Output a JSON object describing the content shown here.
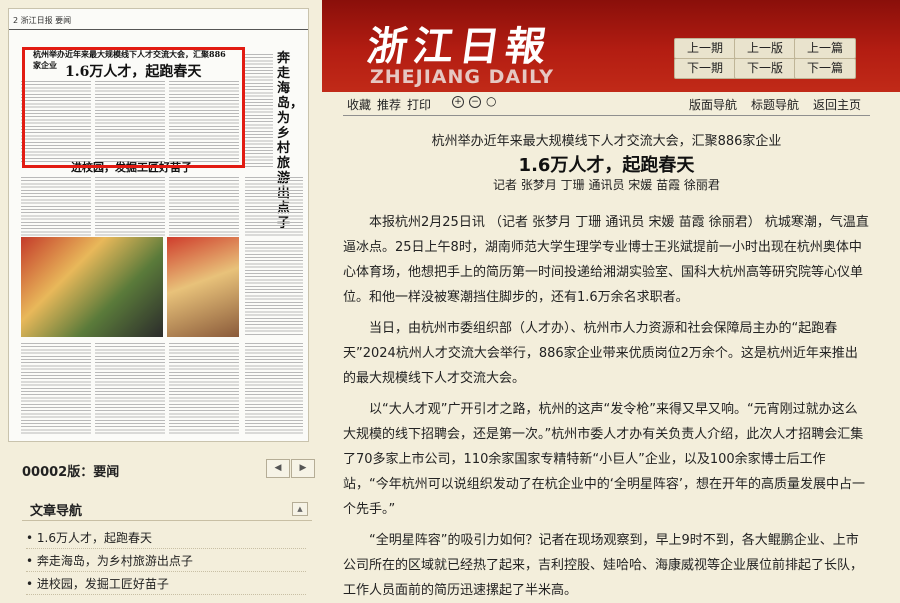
{
  "header": {
    "logo_cn": "浙江日報",
    "logo_en": "ZHEJIANG DAILY",
    "nav": [
      "上一期",
      "上一版",
      "上一篇",
      "下一期",
      "下一版",
      "下一篇"
    ]
  },
  "thumbnail": {
    "masthead": "2 浙江日报 要闻",
    "headline_small": "杭州举办近年来最大规模线下人才交流大会，汇聚886家企业",
    "headline_big": "1.6万人才，起跑春天",
    "vertical_headline": "奔走海岛，为乡村旅游出点子",
    "headline_mid": "进校园，发掘工匠好苗子"
  },
  "edition": {
    "label": "00002版：要闻",
    "prev": "◀",
    "next": "▶"
  },
  "article_nav": {
    "title": "文章导航",
    "collapse": "▲",
    "items": [
      "1.6万人才，起跑春天",
      "奔走海岛，为乡村旅游出点子",
      "进校园，发掘工匠好苗子"
    ]
  },
  "toolbar": {
    "fav": "收藏",
    "rec": "推荐",
    "print": "打印",
    "zoom_in": "+",
    "zoom_out": "−",
    "zoom_reset": "○",
    "page_nav": "版面导航",
    "title_nav": "标题导航",
    "home": "返回主页"
  },
  "article": {
    "subtitle": "杭州举办近年来最大规模线下人才交流大会，汇聚886家企业",
    "title": "1.6万人才，起跑春天",
    "byline": "记者 张梦月 丁珊 通讯员 宋媛 苗霞 徐丽君",
    "paragraphs": [
      "本报杭州2月25日讯 （记者 张梦月 丁珊 通讯员 宋媛 苗霞 徐丽君） 杭城寒潮，气温直逼冰点。25日上午8时，湖南师范大学生理学专业博士王兆斌提前一小时出现在杭州奥体中心体育场，他想把手上的简历第一时间投递给湘湖实验室、国科大杭州高等研究院等心仪单位。和他一样没被寒潮挡住脚步的，还有1.6万余名求职者。",
      "当日，由杭州市委组织部（人才办）、杭州市人力资源和社会保障局主办的“起跑春天”2024杭州人才交流大会举行，886家企业带来优质岗位2万余个。这是杭州近年来推出的最大规模线下人才交流大会。",
      "以“大人才观”广开引才之路，杭州的这声“发令枪”来得又早又响。“元宵刚过就办这么大规模的线下招聘会，还是第一次。”杭州市委人才办有关负责人介绍，此次人才招聘会汇集了70多家上市公司，110余家国家专精特新“小巨人”企业，以及100余家博士后工作站，“今年杭州可以说组织发动了在杭企业中的‘全明星阵容’，想在开年的高质量发展中占一个先手。”",
      "“全明星阵容”的吸引力如何？记者在现场观察到，早上9时不到，各大鲲鹏企业、上市公司所在的区域就已经热了起来，吉利控股、娃哈哈、海康威视等企业展位前排起了长队，工作人员面前的简历迅速摞起了半米高。"
    ]
  }
}
